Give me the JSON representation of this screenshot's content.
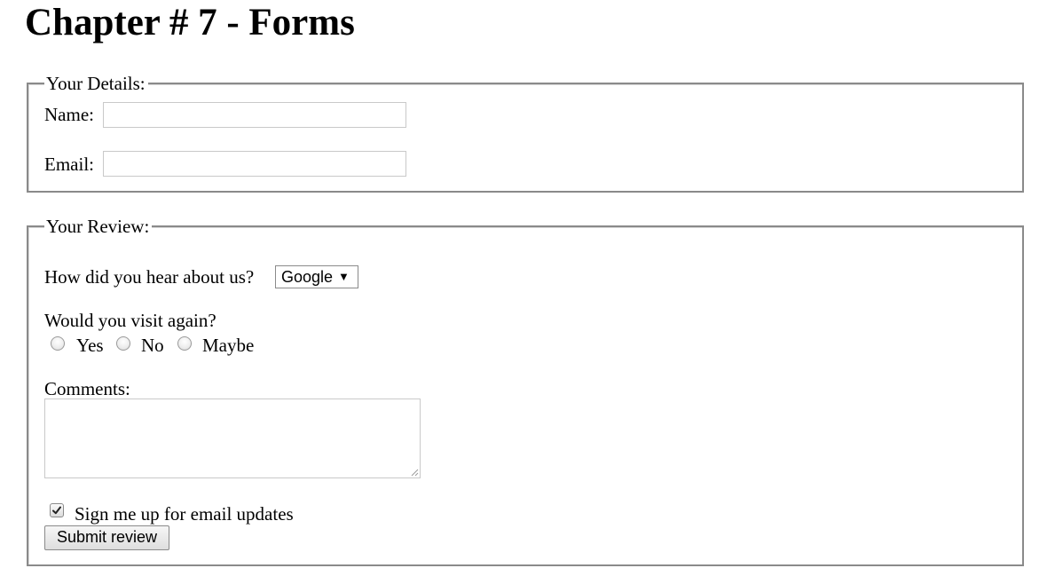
{
  "page": {
    "title": "Chapter # 7 - Forms"
  },
  "details": {
    "legend": "Your Details:",
    "name_label": "Name:",
    "name_value": "",
    "email_label": "Email:",
    "email_value": ""
  },
  "review": {
    "legend": "Your Review:",
    "hear_label": "How did you hear about us?",
    "hear_selected": "Google",
    "visit_label": "Would you visit again?",
    "visit_options": [
      {
        "label": "Yes",
        "checked": false
      },
      {
        "label": "No",
        "checked": false
      },
      {
        "label": "Maybe",
        "checked": false
      }
    ],
    "comments_label": "Comments:",
    "comments_value": "",
    "updates_label": "Sign me up for email updates",
    "updates_checked": true,
    "submit_label": "Submit review"
  },
  "icons": {
    "select_arrow": "chevron-down-icon",
    "checkbox_mark": "checkmark-icon",
    "textarea_grip": "resize-grip-icon"
  }
}
